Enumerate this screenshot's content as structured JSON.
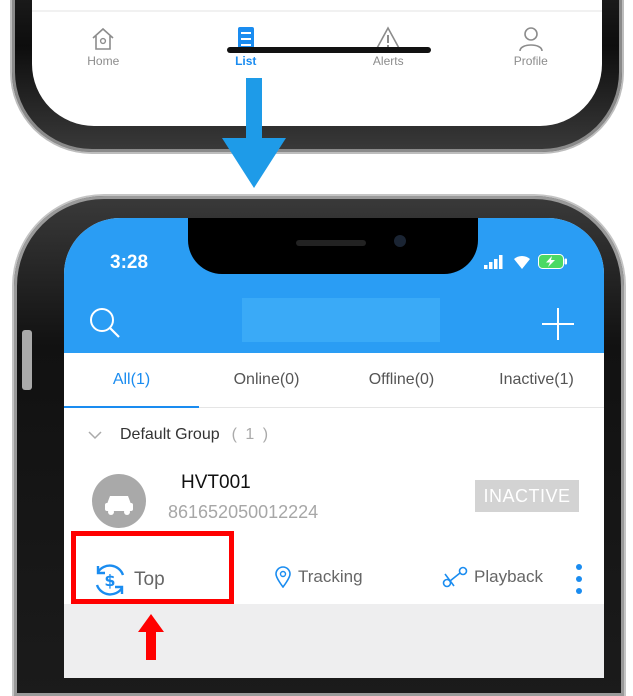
{
  "top_tabbar": {
    "items": [
      {
        "label": "Home",
        "icon": "home-icon",
        "active": false
      },
      {
        "label": "List",
        "icon": "list-icon",
        "active": true
      },
      {
        "label": "Alerts",
        "icon": "alert-icon",
        "active": false
      },
      {
        "label": "Profile",
        "icon": "profile-icon",
        "active": false
      }
    ]
  },
  "status_bar": {
    "time": "3:28",
    "icons": [
      "signal-icon",
      "wifi-icon",
      "battery-charging-icon"
    ]
  },
  "header": {
    "left_icon": "search-icon",
    "right_icon": "plus-icon"
  },
  "filter_tabs": [
    {
      "label": "All(1)",
      "active": true
    },
    {
      "label": "Online(0)",
      "active": false
    },
    {
      "label": "Offline(0)",
      "active": false
    },
    {
      "label": "Inactive(1)",
      "active": false
    }
  ],
  "group": {
    "name": "Default Group",
    "count": "( 1 )"
  },
  "device": {
    "name": "HVT001",
    "imei": "861652050012224",
    "status": "INACTIVE",
    "actions": {
      "top": "Top",
      "tracking": "Tracking",
      "playback": "Playback"
    }
  },
  "colors": {
    "accent": "#2a9df4",
    "active_tab": "#1a8cf0",
    "highlight": "#ff0000",
    "arrow": "#1e9be8"
  }
}
